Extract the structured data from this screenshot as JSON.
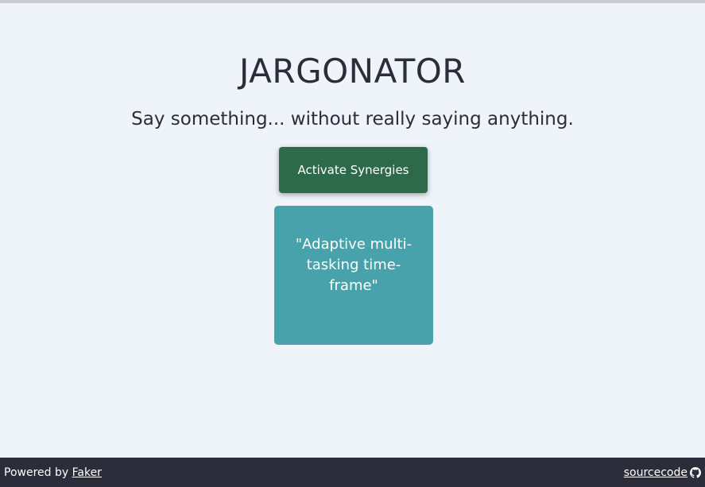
{
  "app": {
    "title": "JARGONATOR",
    "tagline": "Say something... without really saying anything."
  },
  "actions": {
    "generate_label": "Activate Synergies"
  },
  "phrase": {
    "text": "\"Adaptive multi-tasking time-frame\""
  },
  "footer": {
    "powered_by_prefix": "Powered by",
    "powered_by_link": "Faker",
    "source_link": "sourcecode",
    "source_icon": "github-icon"
  },
  "colors": {
    "background": "#eef4fa",
    "button": "#2d6a4a",
    "card": "#47a2ab",
    "footer": "#2b2e3a",
    "text": "#2b2e3a"
  }
}
